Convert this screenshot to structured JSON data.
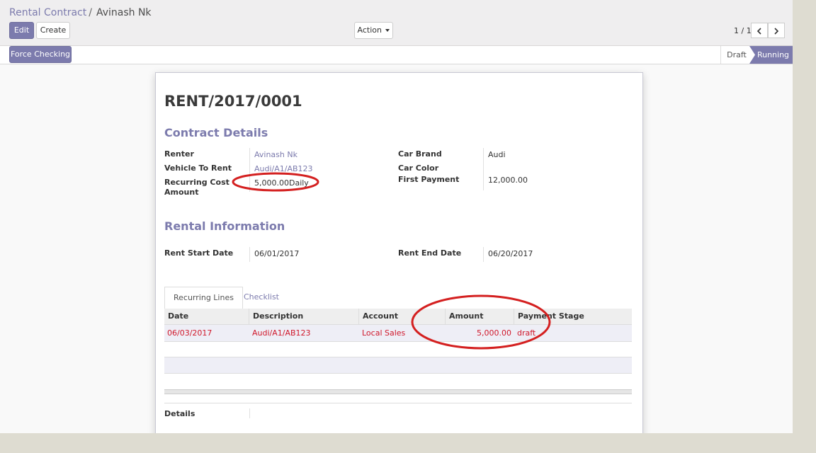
{
  "breadcrumb": {
    "parent": "Rental Contract",
    "separator": "/",
    "current": "Avinash Nk"
  },
  "buttons": {
    "edit": "Edit",
    "create": "Create",
    "action": "Action",
    "force_checking": "Force Checking"
  },
  "pager": {
    "value": "1 / 1",
    "prev_icon": "chevron-left-icon",
    "next_icon": "chevron-right-icon"
  },
  "status": {
    "stages": [
      "Draft",
      "Running"
    ],
    "active": "Running"
  },
  "record": {
    "name": "RENT/2017/0001",
    "contract_details": {
      "heading": "Contract Details",
      "renter_label": "Renter",
      "renter": "Avinash Nk",
      "vehicle_label": "Vehicle To Rent",
      "vehicle": "Audi/A1/AB123",
      "recurring_label_1": "Recurring Cost",
      "recurring_label_2": "Amount",
      "recurring_amount": "5,000.00",
      "recurring_period": "Daily",
      "car_brand_label": "Car Brand",
      "car_brand": "Audi",
      "car_color_label": "Car Color",
      "car_color": "",
      "first_payment_label": "First Payment",
      "first_payment": "12,000.00"
    },
    "rental_information": {
      "heading": "Rental Information",
      "start_label": "Rent Start Date",
      "start": "06/01/2017",
      "end_label": "Rent End Date",
      "end": "06/20/2017"
    },
    "tabs": [
      "Recurring Lines",
      "Checklist"
    ],
    "recurring_lines": {
      "columns": [
        "Date",
        "Description",
        "Account",
        "Amount",
        "Payment Stage"
      ],
      "rows": [
        {
          "date": "06/03/2017",
          "description": "Audi/A1/AB123",
          "account": "Local Sales",
          "amount": "5,000.00",
          "stage": "draft"
        }
      ]
    },
    "details_label": "Details"
  },
  "colors": {
    "brand": "#7c7bad",
    "overdue_red": "#d0182b",
    "annotation_red": "#d42020"
  }
}
